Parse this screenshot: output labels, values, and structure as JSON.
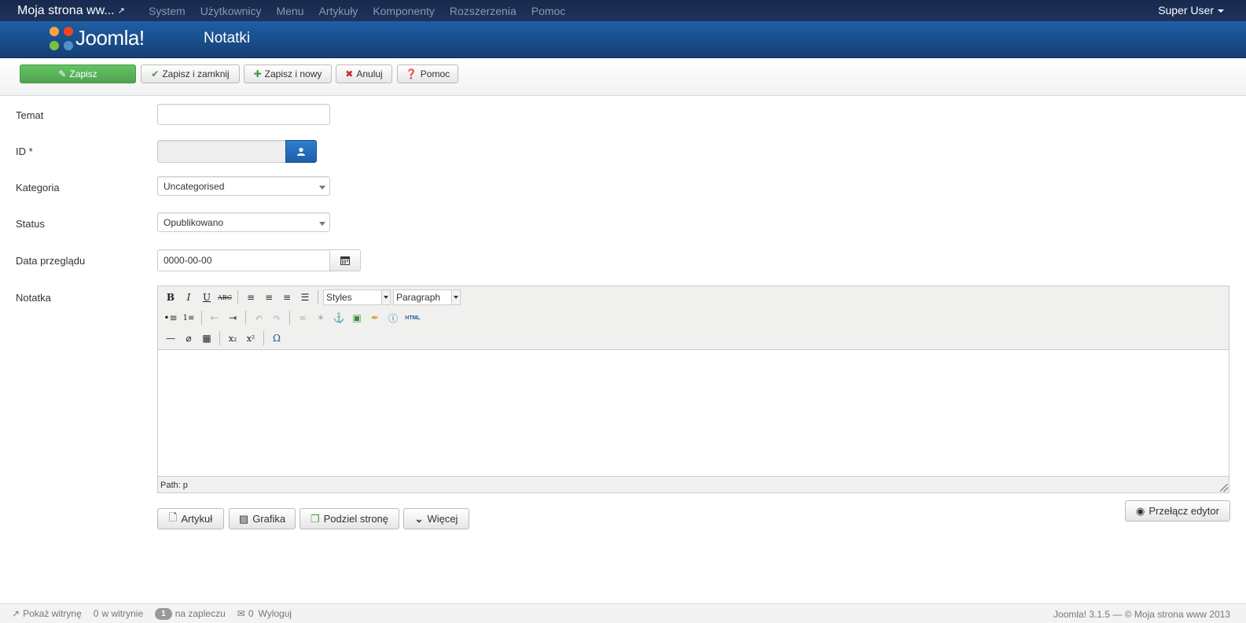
{
  "topnav": {
    "brand": "Moja strona ww...",
    "menu": [
      "System",
      "Użytkownicy",
      "Menu",
      "Artykuły",
      "Komponenty",
      "Rozszerzenia",
      "Pomoc"
    ],
    "user": "Super User"
  },
  "header": {
    "logo_text": "Joomla!",
    "title": "Notatki"
  },
  "toolbar": {
    "save": "Zapisz",
    "save_close": "Zapisz i zamknij",
    "save_new": "Zapisz i nowy",
    "cancel": "Anuluj",
    "help": "Pomoc"
  },
  "form": {
    "subject_label": "Temat",
    "subject_value": "",
    "id_label": "ID *",
    "category_label": "Kategoria",
    "category_value": "Uncategorised",
    "status_label": "Status",
    "status_value": "Opublikowano",
    "review_date_label": "Data przeglądu",
    "review_date_value": "0000-00-00",
    "note_label": "Notatka"
  },
  "editor": {
    "styles": "Styles",
    "paragraph": "Paragraph",
    "path": "Path: p",
    "html_label": "HTML"
  },
  "editor_buttons": {
    "article": "Artykuł",
    "image": "Grafika",
    "pagebreak": "Podziel stronę",
    "more": "Więcej",
    "toggle_editor": "Przełącz edytor"
  },
  "footer": {
    "view_site": "Pokaż witrynę",
    "site_count": "0",
    "site_label": "w witrynie",
    "admin_count": "1",
    "admin_label": "na zapleczu",
    "messages_count": "0",
    "logout": "Wyloguj",
    "copyright": "Joomla! 3.1.5 — © Moja strona www 2013"
  }
}
